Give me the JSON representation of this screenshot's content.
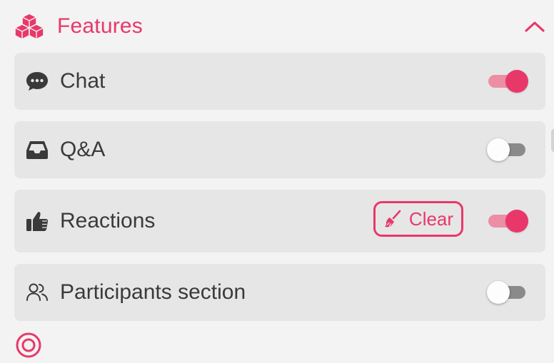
{
  "section": {
    "title": "Features",
    "icon": "cubes-icon",
    "collapse_icon": "chevron-up-icon"
  },
  "features": [
    {
      "label": "Chat",
      "icon": "comment-dots-icon",
      "enabled": true
    },
    {
      "label": "Q&A",
      "icon": "inbox-icon",
      "enabled": false
    },
    {
      "label": "Reactions",
      "icon": "thumbs-up-icon",
      "enabled": true,
      "action": {
        "label": "Clear",
        "icon": "broom-icon"
      }
    },
    {
      "label": "Participants section",
      "icon": "users-icon",
      "enabled": false
    }
  ],
  "colors": {
    "accent": "#e8386a",
    "accent_light": "#ec8ea6",
    "card_bg": "#e6e6e6",
    "page_bg": "#f3f3f3",
    "text": "#3a3a3a",
    "toggle_off_track": "#8a8a8a"
  }
}
